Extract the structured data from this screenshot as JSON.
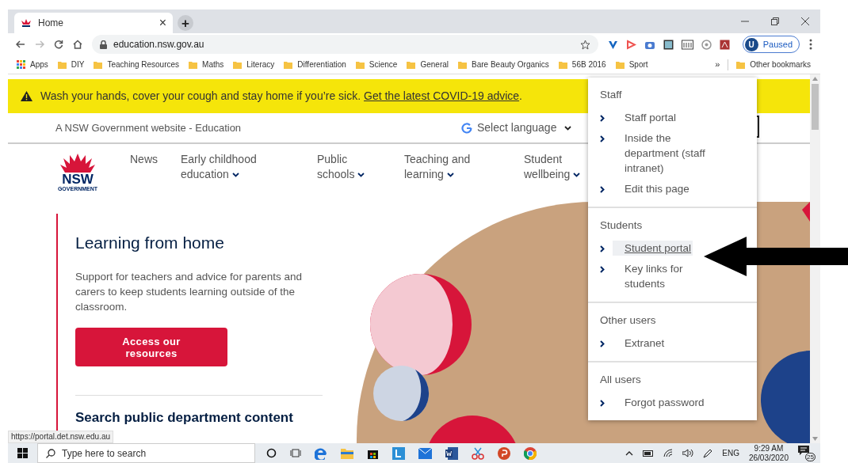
{
  "browser": {
    "tab": {
      "title": "Home",
      "close": "×"
    },
    "new_tab": "+",
    "url": "education.nsw.gov.au",
    "profile": {
      "initial": "U",
      "status": "Paused"
    },
    "bookmarks": [
      {
        "label": "Apps",
        "kind": "apps"
      },
      {
        "label": "DIY",
        "kind": "folder"
      },
      {
        "label": "Teaching Resources",
        "kind": "folder"
      },
      {
        "label": "Maths",
        "kind": "folder"
      },
      {
        "label": "Literacy",
        "kind": "folder"
      },
      {
        "label": "Differentiation",
        "kind": "folder"
      },
      {
        "label": "Science",
        "kind": "folder"
      },
      {
        "label": "General",
        "kind": "folder"
      },
      {
        "label": "Bare Beauty Organics",
        "kind": "folder"
      },
      {
        "label": "56B 2016",
        "kind": "folder"
      },
      {
        "label": "Sport",
        "kind": "folder"
      }
    ],
    "bookmarks_overflow": "»",
    "other_bookmarks": "Other bookmarks"
  },
  "banner": {
    "text": "Wash your hands, cover your cough and stay home if you’re sick.",
    "link": "Get the latest COVID-19 advice",
    "suffix": "."
  },
  "gov_bar": {
    "text": "A NSW Government website - Education",
    "language": "Select language"
  },
  "logo": {
    "name": "NSW",
    "subtitle": "GOVERNMENT"
  },
  "nav": [
    {
      "label": "News",
      "dropdown": false
    },
    {
      "label": "Early childhood education",
      "dropdown": true
    },
    {
      "label": "Public schools",
      "dropdown": true
    },
    {
      "label": "Teaching and learning",
      "dropdown": true
    },
    {
      "label": "Student wellbeing",
      "dropdown": true
    }
  ],
  "hero": {
    "title": "Learning from home",
    "body": "Support for teachers and advice for parents and carers to keep students learning outside of the classroom.",
    "button": "Access our resources",
    "search_heading": "Search public department content"
  },
  "menu": {
    "sections": [
      {
        "heading": "Staff",
        "items": [
          {
            "label": "Staff portal",
            "highlighted": false
          },
          {
            "label": "Inside the department (staff intranet)",
            "highlighted": false
          },
          {
            "label": "Edit this page",
            "highlighted": false
          }
        ]
      },
      {
        "heading": "Students",
        "items": [
          {
            "label": "Student portal",
            "highlighted": true
          },
          {
            "label": "Key links for students",
            "highlighted": false
          }
        ]
      },
      {
        "heading": "Other users",
        "items": [
          {
            "label": "Extranet",
            "highlighted": false
          }
        ]
      },
      {
        "heading": "All users",
        "items": [
          {
            "label": "Forgot password",
            "highlighted": false
          }
        ]
      }
    ]
  },
  "status_url": "https://portal.det.nsw.edu.au",
  "taskbar": {
    "search_placeholder": "Type here to search",
    "language": "ENG",
    "time": "9:29 AM",
    "date": "26/03/2020",
    "notifications": "25"
  }
}
